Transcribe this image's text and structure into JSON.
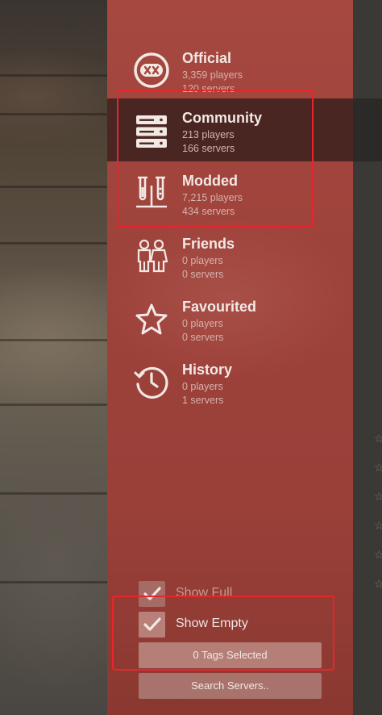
{
  "categories": [
    {
      "title": "Official",
      "players": "3,359 players",
      "servers": "120 servers",
      "icon": "official-icon",
      "selected": false
    },
    {
      "title": "Community",
      "players": "213 players",
      "servers": "166 servers",
      "icon": "server-stack-icon",
      "selected": true
    },
    {
      "title": "Modded",
      "players": "7,215 players",
      "servers": "434 servers",
      "icon": "test-tubes-icon",
      "selected": false
    },
    {
      "title": "Friends",
      "players": "0 players",
      "servers": "0 servers",
      "icon": "friends-icon",
      "selected": false
    },
    {
      "title": "Favourited",
      "players": "0 players",
      "servers": "0 servers",
      "icon": "star-icon",
      "selected": false
    },
    {
      "title": "History",
      "players": "0 players",
      "servers": "1 servers",
      "icon": "history-icon",
      "selected": false
    }
  ],
  "filters": {
    "show_full_label": "Show Full",
    "show_full_checked": true,
    "show_empty_label": "Show Empty",
    "show_empty_checked": true
  },
  "tags_button_label": "0 Tags Selected",
  "search_placeholder": "Search Servers..",
  "colors": {
    "panel": "#a64840",
    "selected_row": "#4a2622",
    "annotation": "#e6262b"
  }
}
